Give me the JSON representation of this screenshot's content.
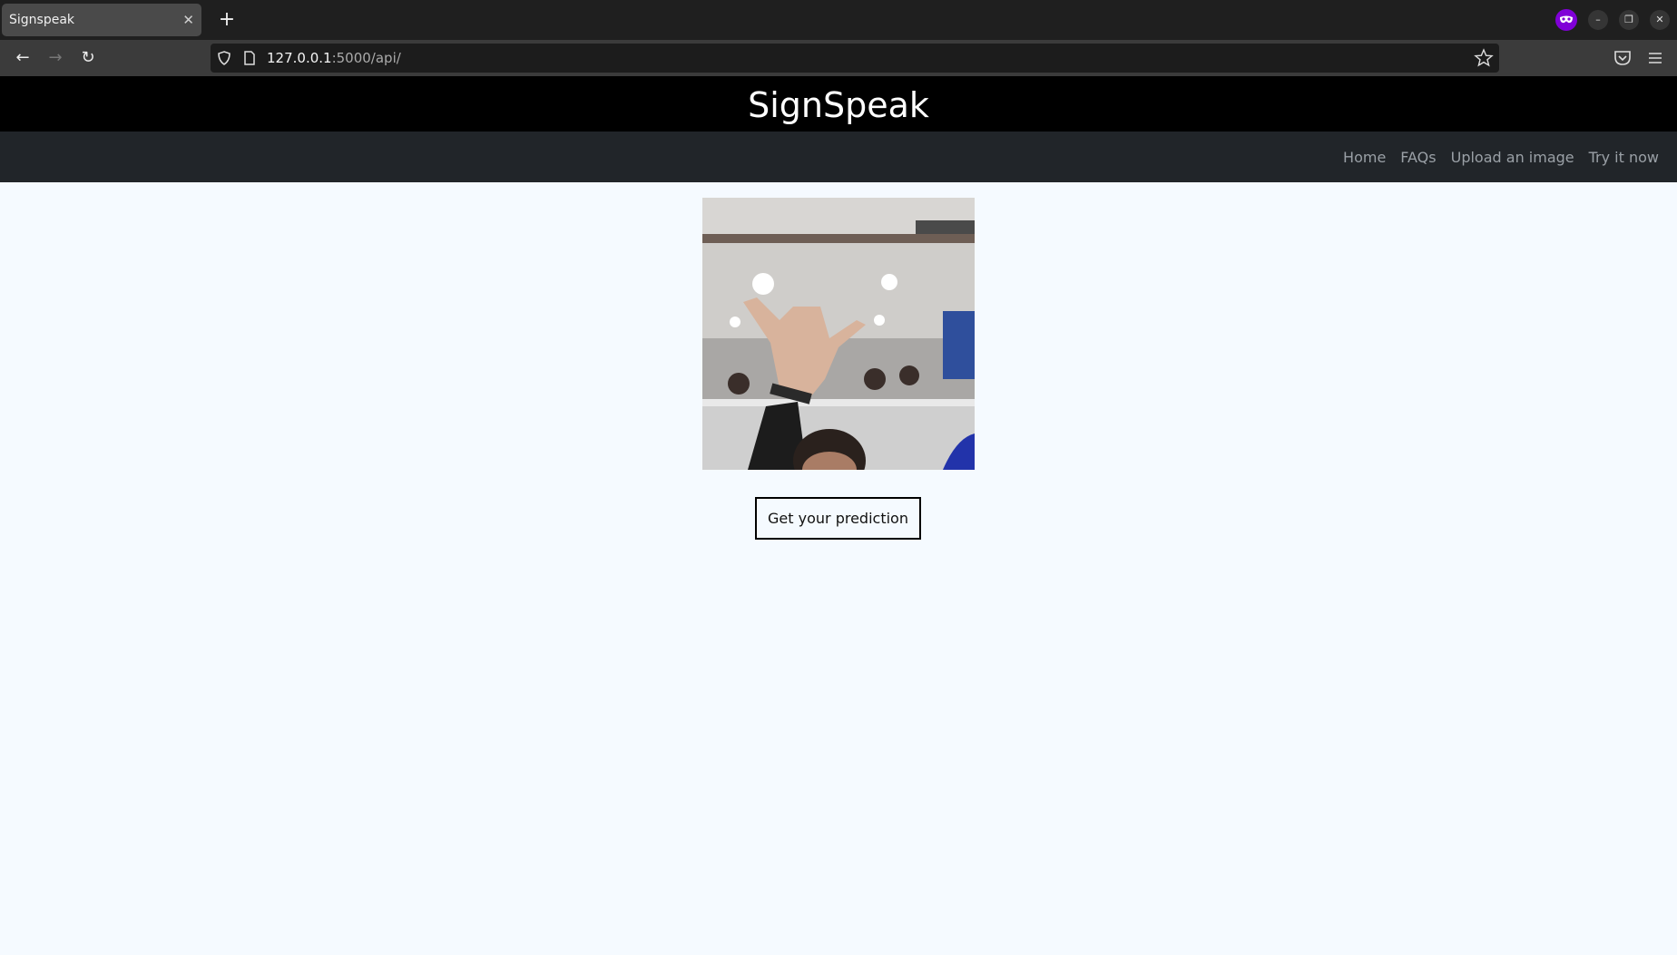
{
  "browser": {
    "tab": {
      "title": "Signspeak",
      "close_icon": "close-icon"
    },
    "new_tab_icon": "plus-icon",
    "window_controls": {
      "private_icon": "private-browsing-mask-icon",
      "minimize": "minimize-icon",
      "restore": "restore-icon",
      "close": "close-icon"
    },
    "url": {
      "host": "127.0.0.1",
      "rest": ":5000/api/"
    },
    "icons": {
      "back": "arrow-left-icon",
      "forward": "arrow-right-icon",
      "reload": "reload-icon",
      "shield": "shield-icon",
      "page": "page-icon",
      "bookmark": "star-icon",
      "pocket": "pocket-icon",
      "menu": "hamburger-menu-icon"
    }
  },
  "site": {
    "title": "SignSpeak",
    "nav": [
      "Home",
      "FAQs",
      "Upload an image",
      "Try it now"
    ],
    "image_alt": "Captured webcam image of a hand sign",
    "predict_button": "Get your prediction"
  }
}
